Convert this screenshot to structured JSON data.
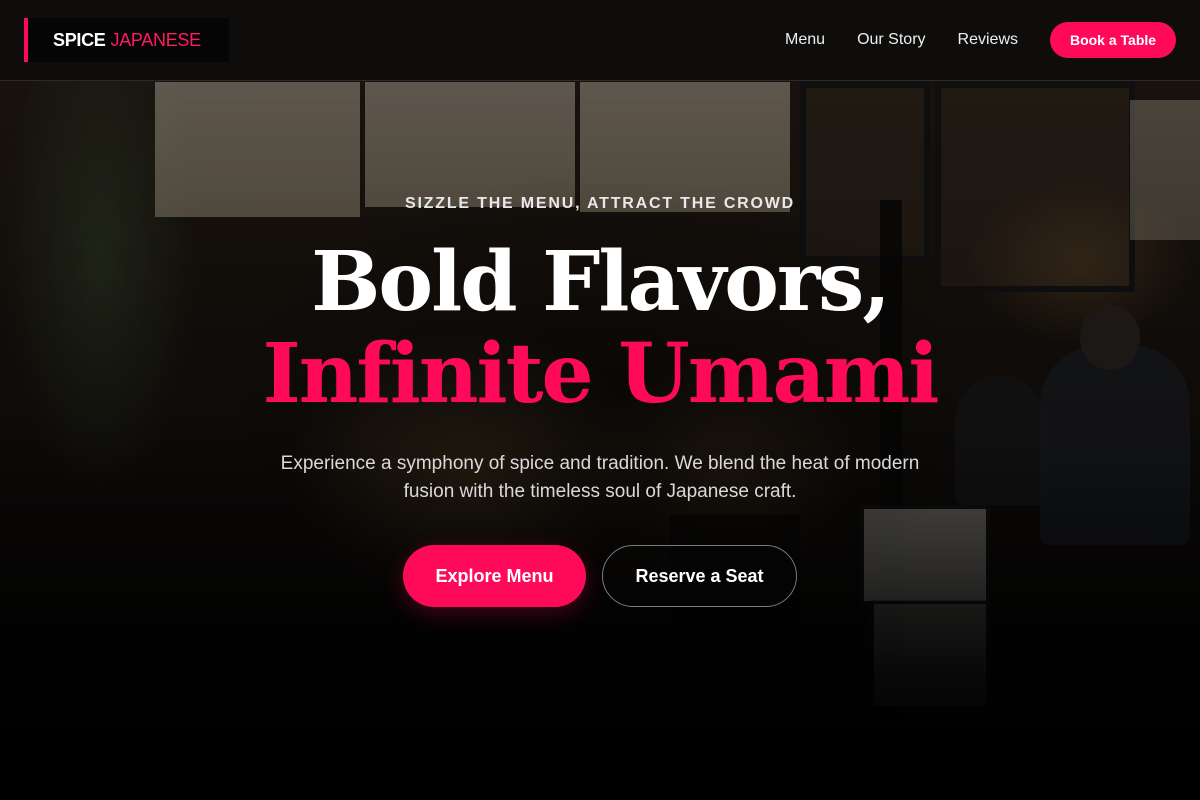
{
  "nav": {
    "logo": {
      "primary": "SPICE",
      "accent": "JAPANESE"
    },
    "links": [
      {
        "label": "Menu"
      },
      {
        "label": "Our Story"
      },
      {
        "label": "Reviews"
      }
    ],
    "cta_label": "Book a Table"
  },
  "hero": {
    "eyebrow": "SIZZLE THE MENU, ATTRACT THE CROWD",
    "headline_line1": "Bold Flavors,",
    "headline_line2": "Infinite Umami",
    "subtitle": "Experience a symphony of spice and tradition. We blend the heat of modern fusion with the timeless soul of Japanese craft.",
    "primary_cta": "Explore Menu",
    "secondary_cta": "Reserve a Seat"
  },
  "colors": {
    "accent": "#ff0a5a",
    "background": "#080808",
    "text": "#ffffff"
  }
}
